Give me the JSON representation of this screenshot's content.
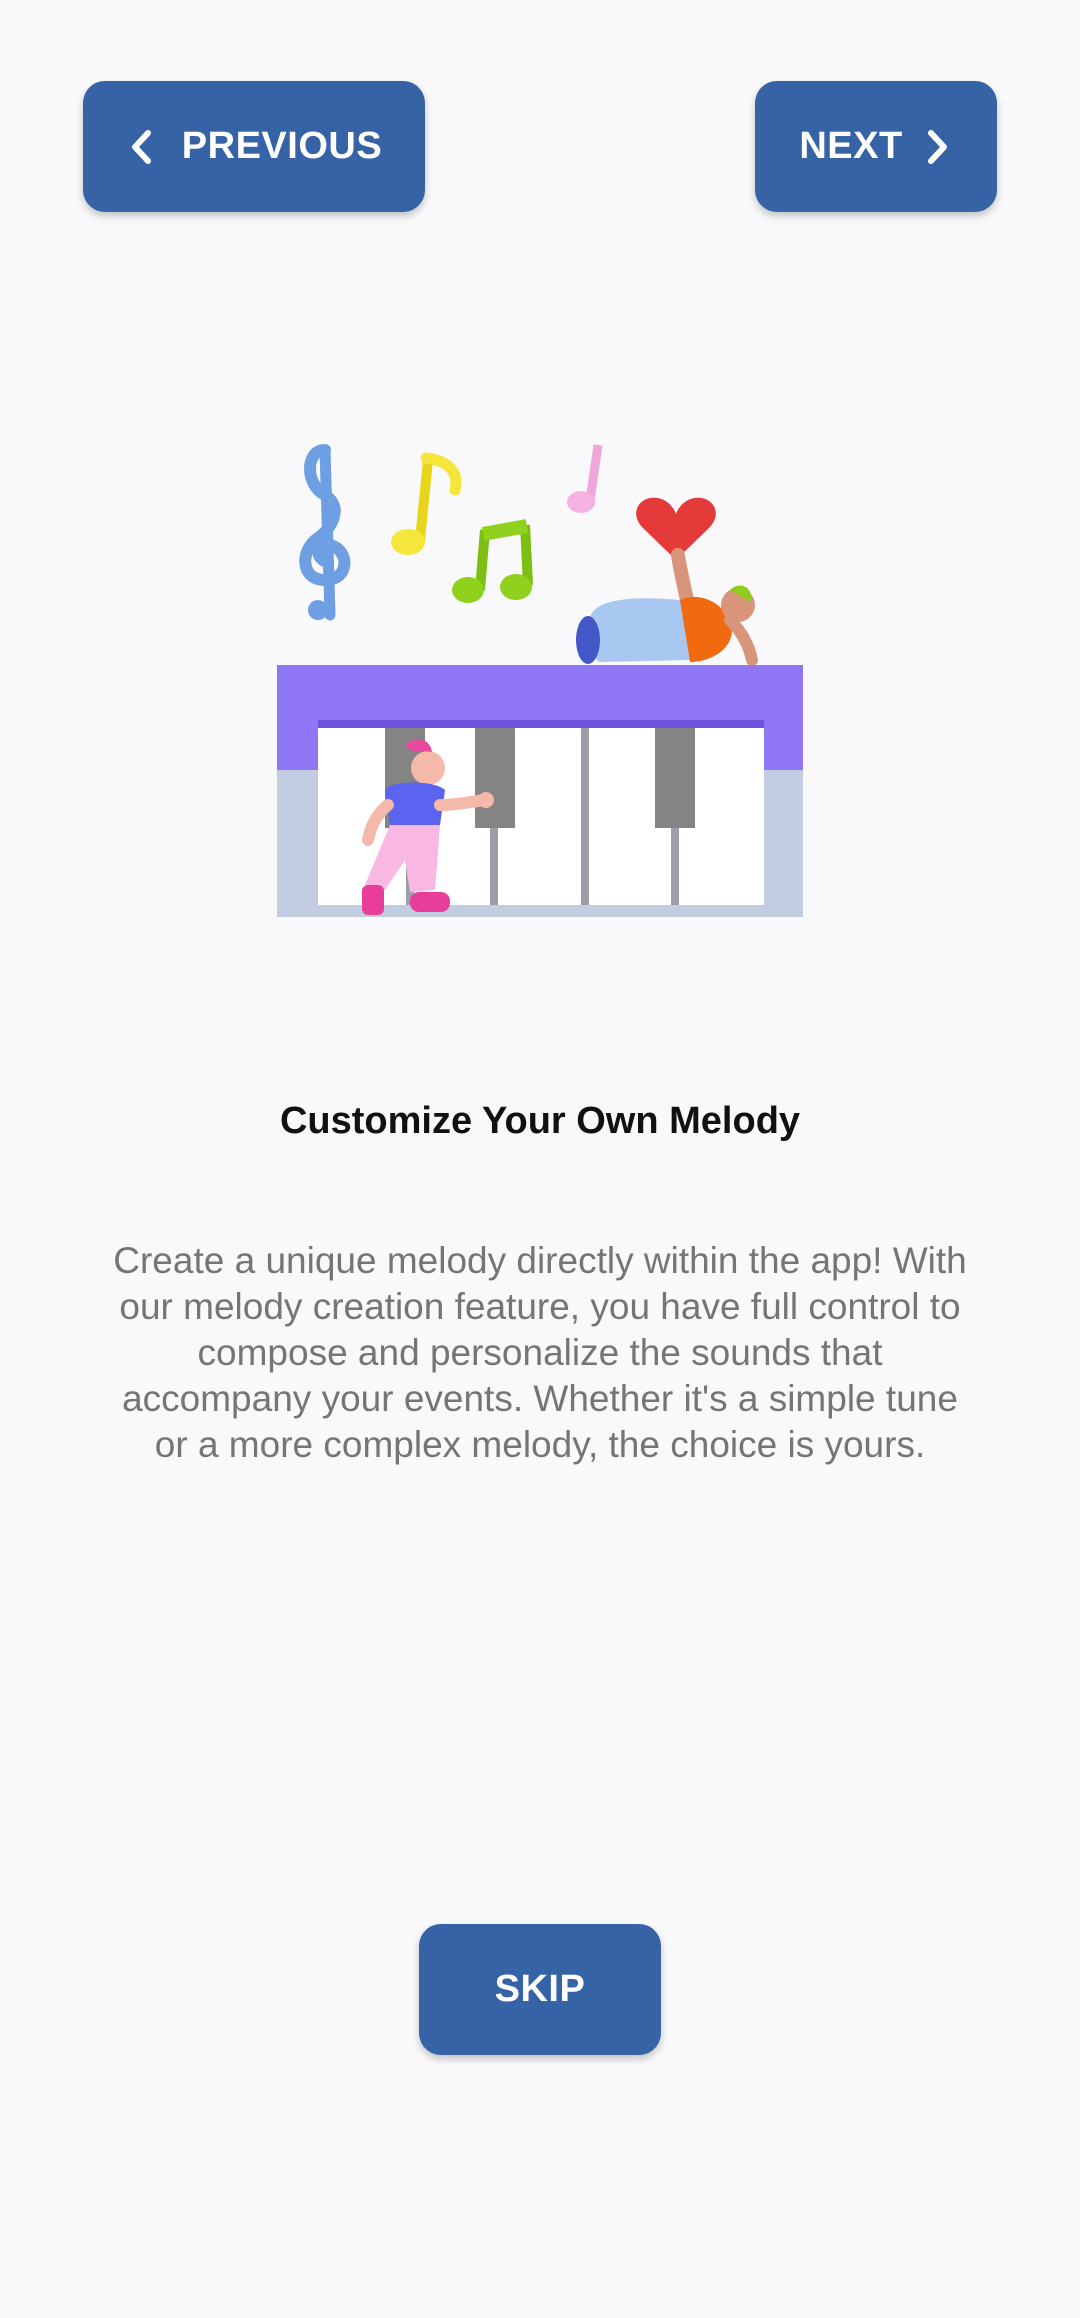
{
  "nav": {
    "previous_label": "PREVIOUS",
    "next_label": "NEXT"
  },
  "content": {
    "title": "Customize Your Own Melody",
    "description": "Create a unique melody directly within the app! With our melody creation feature, you have full control to compose and personalize the sounds that accompany your events. Whether it's a simple tune or a more complex melody, the choice is yours."
  },
  "footer": {
    "skip_label": "SKIP"
  },
  "illustration": {
    "subject": "piano-music-illustration"
  },
  "colors": {
    "primary_button": "#3563a6",
    "background": "#f9f9fb",
    "title_text": "#111111",
    "body_text": "#757575"
  }
}
